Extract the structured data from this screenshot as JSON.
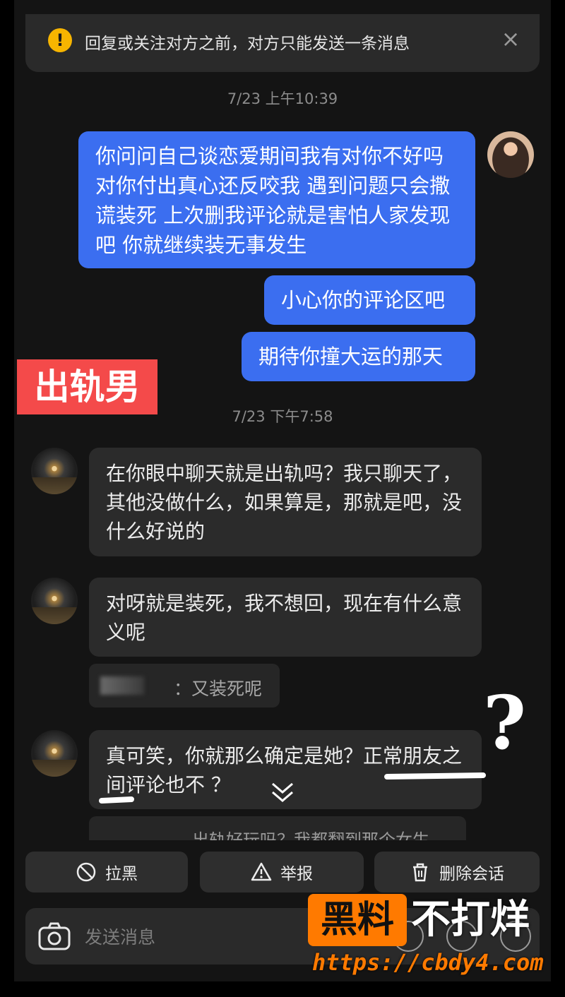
{
  "notice": {
    "text": "回复或关注对方之前，对方只能发送一条消息",
    "close": "×"
  },
  "timestamps": [
    "7/23 上午10:39",
    "7/23 下午7:58"
  ],
  "my_messages": [
    "你问问自己谈恋爱期间我有对你不好吗 对你付出真心还反咬我 遇到问题只会撒谎装死 上次删我评论就是害怕人家发现吧 你就继续装无事发生",
    "小心你的评论区吧",
    "期待你撞大运的那天"
  ],
  "label": "出轨男",
  "other_messages": [
    "在你眼中聊天就是出轨吗？我只聊天了，其他没做什么，如果算是，那就是吧，没什么好说的",
    "对呀就是装死，我不想回，现在有什么意义呢",
    "真可笑，你就那么确定是她？正常朋友之间评论也不     ？"
  ],
  "quote_reply": "：又装死呢",
  "partial_message": "出轨好玩吗？我都翻到那个女生",
  "actions": {
    "block": "拉黑",
    "report": "举报",
    "delete": "删除会话"
  },
  "composer": {
    "placeholder": "发送消息"
  },
  "annotation": "?",
  "watermark": {
    "box": "黑料",
    "text": "不打烊",
    "url": "https://cbdy4.com"
  },
  "colors": {
    "my_bubble": "#3b6ef0",
    "other_bubble": "#2b2b2b",
    "label_red": "#f44a4a",
    "warning": "#f7b500",
    "watermark_orange": "#ff7a00"
  }
}
